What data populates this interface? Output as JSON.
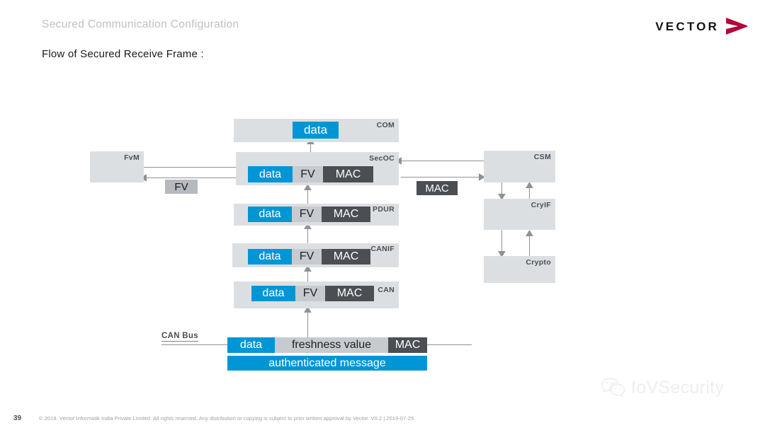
{
  "header": {
    "title": "Secured Communication Configuration",
    "subtitle": "Flow of Secured Receive Frame :",
    "logo_word": "VECTOR",
    "logo_arrow_color": "#b5063b"
  },
  "colors": {
    "module_bg": "#dcdfe2",
    "data_blue": "#0096d6",
    "fv_gray": "#c7cace",
    "mac_dark": "#4b4f54",
    "tag_fv_gray": "#b6b9bd",
    "connector": "#8e9297",
    "label_text": "#4b4f54"
  },
  "diagram": {
    "modules": [
      {
        "name": "com",
        "label": "COM",
        "segments": [
          "data"
        ]
      },
      {
        "name": "secoc",
        "label": "SecOC",
        "segments": [
          "data",
          "FV",
          "MAC"
        ]
      },
      {
        "name": "pdur",
        "label": "PDUR",
        "segments": [
          "data",
          "FV",
          "MAC"
        ]
      },
      {
        "name": "canif",
        "label": "CANIF",
        "segments": [
          "data",
          "FV",
          "MAC"
        ]
      },
      {
        "name": "can",
        "label": "CAN",
        "segments": [
          "data",
          "FV",
          "MAC"
        ]
      },
      {
        "name": "fvm",
        "label": "FvM",
        "segments": []
      },
      {
        "name": "csm",
        "label": "CSM",
        "segments": []
      },
      {
        "name": "cryif",
        "label": "CryIF",
        "segments": []
      },
      {
        "name": "crypto",
        "label": "Crypto",
        "segments": []
      }
    ],
    "segment_labels": {
      "data": "data",
      "fv": "FV",
      "mac": "MAC"
    },
    "tags": {
      "fv": "FV",
      "mac": "MAC"
    },
    "bus": {
      "label": "CAN Bus",
      "frame": {
        "data": "data",
        "freshness": "freshness value",
        "mac": "MAC"
      },
      "authenticated": "authenticated message"
    }
  },
  "footer": {
    "page_number": "39",
    "copyright": "© 2019. Vector Informatik India Private Limited. All rights reserved. Any distribution or copying is subject to prior written approval by Vector. V0.2 | 2019-07-25"
  },
  "watermark": {
    "text": "IoVSecurity",
    "icon": "wechat-icon"
  }
}
